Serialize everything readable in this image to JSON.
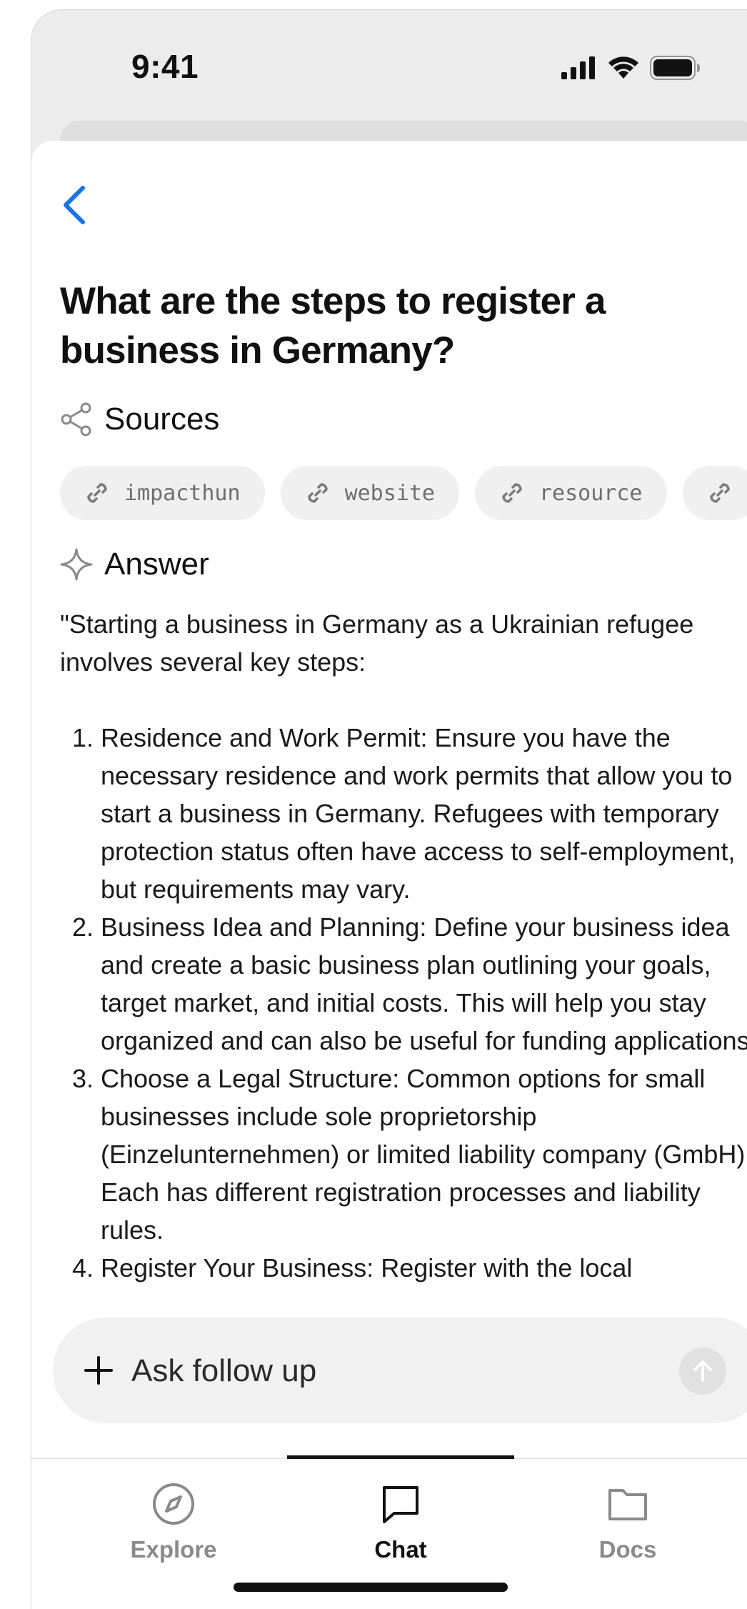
{
  "status_bar": {
    "time": "9:41"
  },
  "question": {
    "title": "What are the steps to register a business in Germany?"
  },
  "sources": {
    "label": "Sources",
    "chips": [
      "impacthun",
      "website",
      "resource"
    ]
  },
  "answer": {
    "label": "Answer",
    "intro": "\"Starting a business in Germany as a Ukrainian refugee involves several key steps:",
    "steps": [
      "Residence and Work Permit: Ensure you have the necessary residence and work permits that allow you to start a business in Germany. Refugees with temporary protection status often have access to self-employment, but requirements may vary.",
      "Business Idea and Planning: Define your business idea and create a basic business plan outlining your goals, target market, and initial costs. This will help you stay organized and can also be useful for funding applications.",
      "Choose a Legal Structure: Common options for small businesses include sole proprietorship (Einzelunternehmen) or limited liability company (GmbH). Each has different registration processes and liability rules.",
      "Register Your Business: Register with the local"
    ]
  },
  "composer": {
    "placeholder": "Ask follow up"
  },
  "tabs": [
    {
      "label": "Explore",
      "icon": "compass-icon"
    },
    {
      "label": "Chat",
      "icon": "chat-bubble-icon",
      "active": true
    },
    {
      "label": "Docs",
      "icon": "folder-icon"
    }
  ],
  "colors": {
    "accent": "#1a73e8",
    "active": "#111111",
    "inactive": "#8a8a8a"
  }
}
